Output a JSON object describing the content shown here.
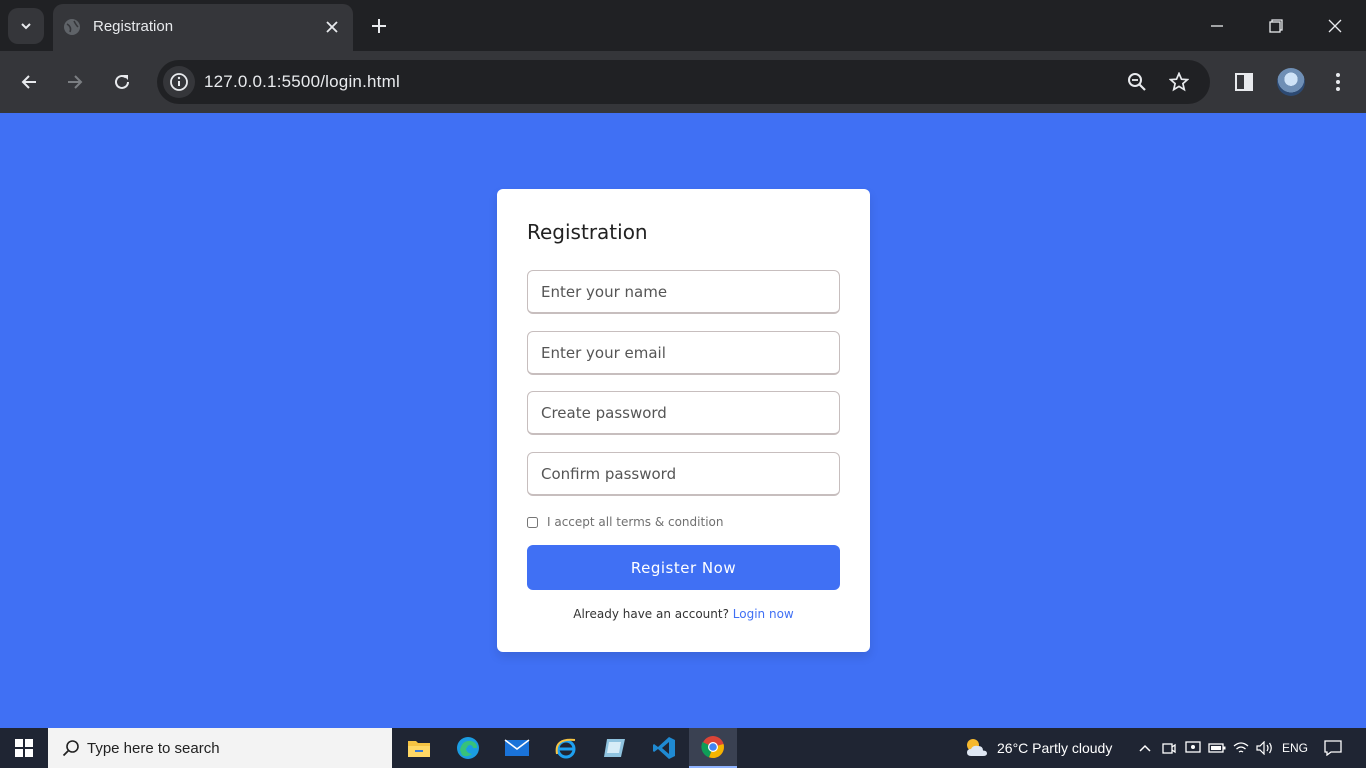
{
  "browser": {
    "tab_title": "Registration",
    "url": "127.0.0.1:5500/login.html"
  },
  "form": {
    "title": "Registration",
    "name_placeholder": "Enter your name",
    "email_placeholder": "Enter your email",
    "password_placeholder": "Create password",
    "confirm_placeholder": "Confirm password",
    "terms_label": "I accept all terms & condition",
    "register_label": "Register Now",
    "account_text": "Already have an account?",
    "login_link": "Login now"
  },
  "taskbar": {
    "search_placeholder": "Type here to search",
    "weather": "26°C  Partly cloudy",
    "language": "ENG"
  },
  "colors": {
    "accent": "#4070f4",
    "chrome_dark": "#202124",
    "chrome_toolbar": "#35363a"
  }
}
